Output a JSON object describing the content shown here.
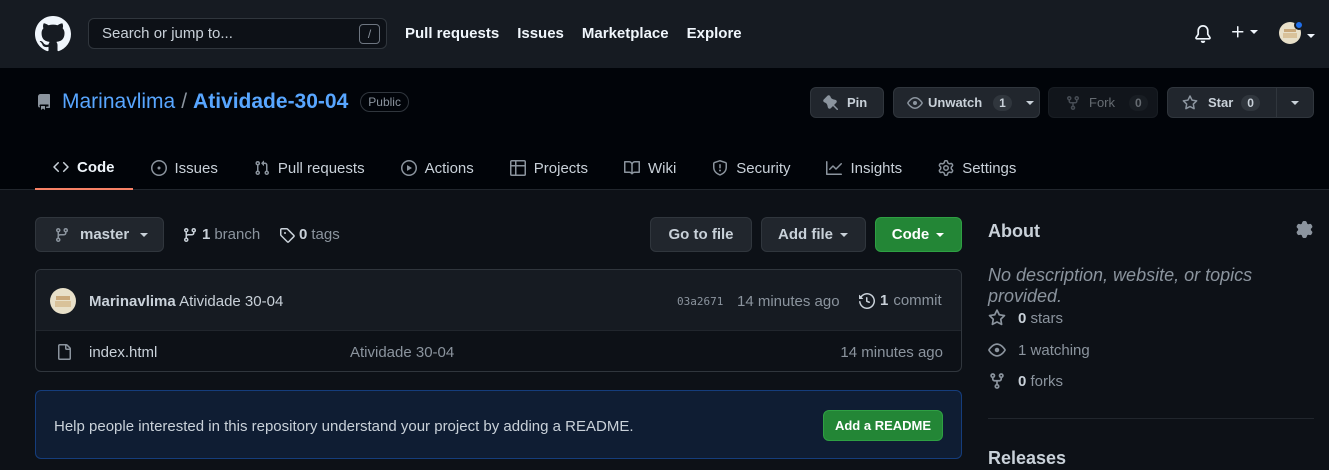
{
  "header": {
    "search_placeholder": "Search or jump to...",
    "search_shortcut": "/",
    "nav": [
      "Pull requests",
      "Issues",
      "Marketplace",
      "Explore"
    ]
  },
  "repo": {
    "owner": "Marinavlima",
    "separator": "/",
    "name": "Atividade-30-04",
    "visibility": "Public",
    "pin_label": "Pin",
    "watch_label": "Unwatch",
    "watch_count": "1",
    "fork_label": "Fork",
    "fork_count": "0",
    "star_label": "Star",
    "star_count": "0"
  },
  "tabs": [
    {
      "label": "Code",
      "icon": "code-icon"
    },
    {
      "label": "Issues",
      "icon": "issue-icon"
    },
    {
      "label": "Pull requests",
      "icon": "pull-request-icon"
    },
    {
      "label": "Actions",
      "icon": "play-icon"
    },
    {
      "label": "Projects",
      "icon": "table-icon"
    },
    {
      "label": "Wiki",
      "icon": "book-icon"
    },
    {
      "label": "Security",
      "icon": "shield-icon"
    },
    {
      "label": "Insights",
      "icon": "graph-icon"
    },
    {
      "label": "Settings",
      "icon": "gear-icon"
    }
  ],
  "toolbar": {
    "branch": "master",
    "branch_count": "1",
    "branch_label": "branch",
    "tag_count": "0",
    "tag_label": "tags",
    "go_to_file": "Go to file",
    "add_file": "Add file",
    "code": "Code"
  },
  "commit": {
    "author": "Marinavlima",
    "message": "Atividade 30-04",
    "sha": "03a2671",
    "time": "14 minutes ago",
    "count": "1",
    "count_label": "commit"
  },
  "files": [
    {
      "name": "index.html",
      "message": "Atividade 30-04",
      "time": "14 minutes ago"
    }
  ],
  "readme": {
    "text": "Help people interested in this repository understand your project by adding a README.",
    "button": "Add a README"
  },
  "about": {
    "title": "About",
    "description": "No description, website, or topics provided.",
    "stars_count": "0",
    "stars_label": "stars",
    "watching_count": "1",
    "watching_label": "watching",
    "forks_count": "0",
    "forks_label": "forks"
  },
  "releases": {
    "title": "Releases"
  },
  "colors": {
    "accent": "#58a6ff",
    "green": "#238636",
    "tab_underline": "#f78166"
  }
}
